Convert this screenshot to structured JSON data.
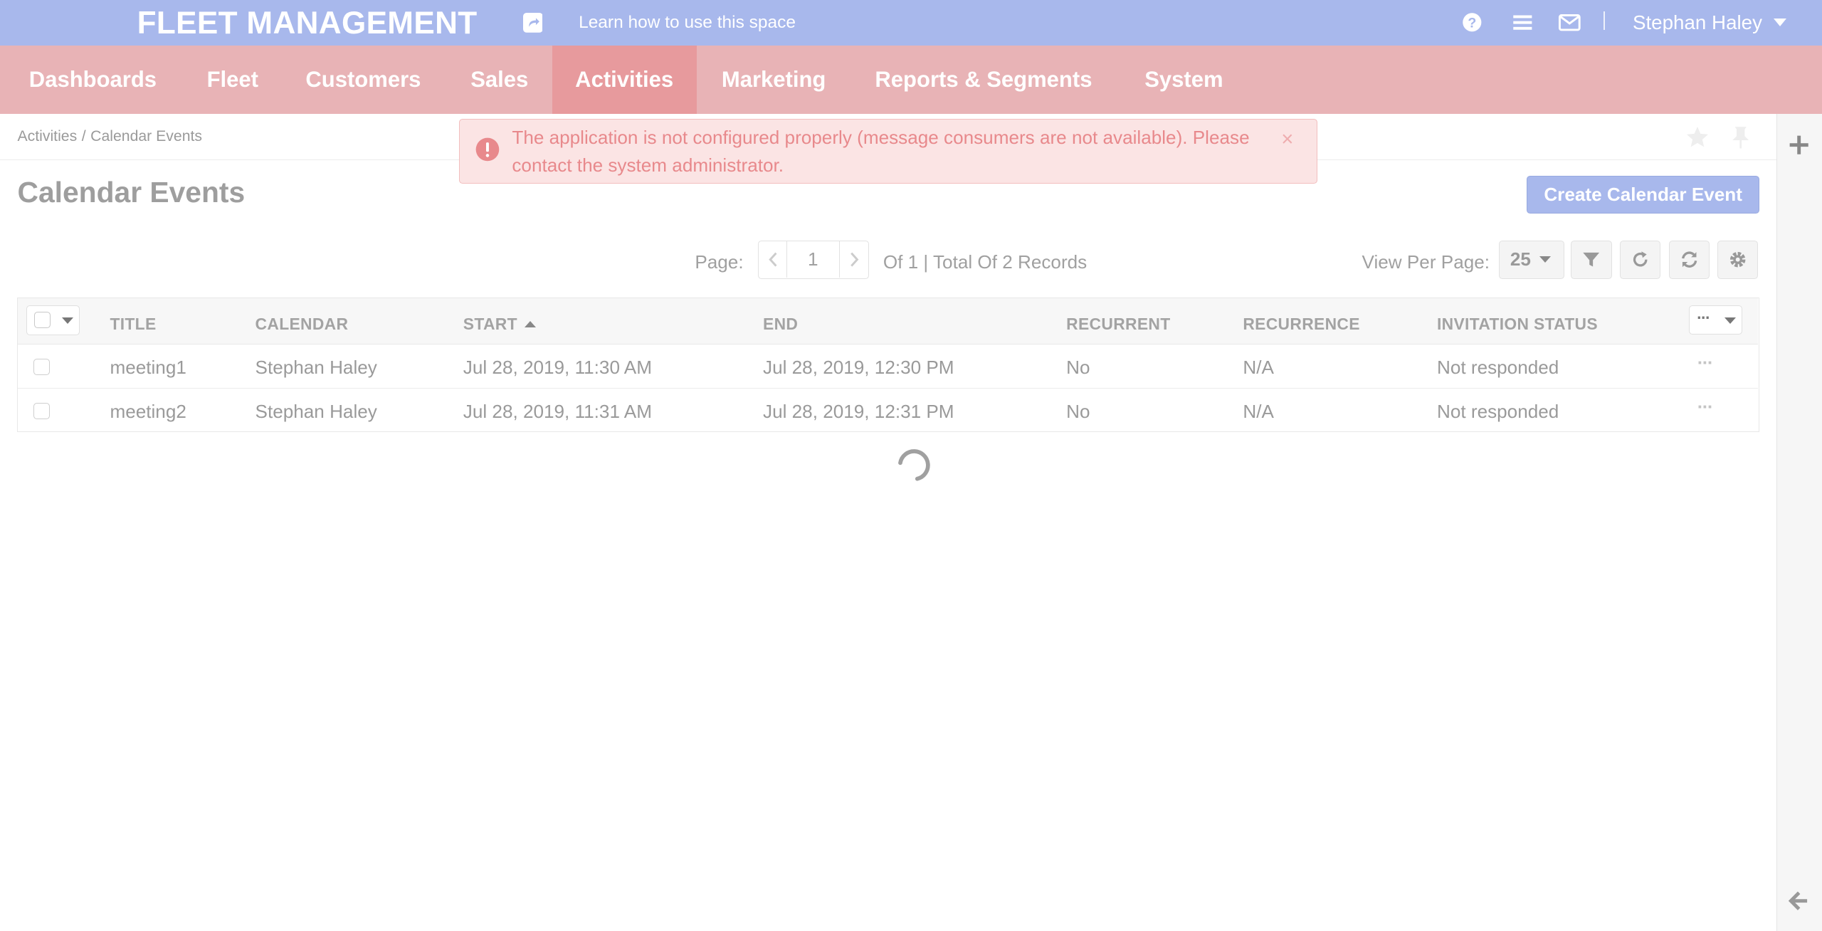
{
  "header": {
    "brand": "FLEET MANAGEMENT",
    "learn_link": "Learn how to use this space",
    "user_name": "Stephan Haley"
  },
  "nav": {
    "items": [
      {
        "label": "Dashboards"
      },
      {
        "label": "Fleet"
      },
      {
        "label": "Customers"
      },
      {
        "label": "Sales"
      },
      {
        "label": "Activities",
        "active": true
      },
      {
        "label": "Marketing"
      },
      {
        "label": "Reports & Segments"
      },
      {
        "label": "System"
      }
    ]
  },
  "breadcrumb": {
    "items": [
      "Activities",
      "Calendar Events"
    ],
    "separator": "/"
  },
  "alert": {
    "message": "The application is not configured properly (message consumers are not available). Please contact the system administrator.",
    "close": "×"
  },
  "page": {
    "title": "Calendar Events",
    "create_button": "Create Calendar Event"
  },
  "pager": {
    "label": "Page:",
    "current": "1",
    "summary": "Of 1 | Total Of 2 Records",
    "per_page_label": "View Per Page:",
    "per_page_value": "25"
  },
  "grid": {
    "columns": [
      "TITLE",
      "CALENDAR",
      "START",
      "END",
      "RECURRENT",
      "RECURRENCE",
      "INVITATION STATUS"
    ],
    "sorted_column": "START",
    "sort_direction": "asc",
    "rows": [
      {
        "title": "meeting1",
        "calendar": "Stephan Haley",
        "start": "Jul 28, 2019, 11:30 AM",
        "end": "Jul 28, 2019, 12:30 PM",
        "recurrent": "No",
        "recurrence": "N/A",
        "status": "Not responded",
        "actions": "···"
      },
      {
        "title": "meeting2",
        "calendar": "Stephan Haley",
        "start": "Jul 28, 2019, 11:31 AM",
        "end": "Jul 28, 2019, 12:31 PM",
        "recurrent": "No",
        "recurrence": "N/A",
        "status": "Not responded",
        "actions": "···"
      }
    ],
    "column_menu_dots": "···"
  },
  "colors": {
    "header_bg": "#a8b8ec",
    "nav_bg": "#e8b3b6",
    "nav_active_bg": "#e79a9d",
    "alert_bg": "#fbe4e4",
    "alert_text": "#e8898c",
    "primary_button": "#a8b8ec"
  }
}
